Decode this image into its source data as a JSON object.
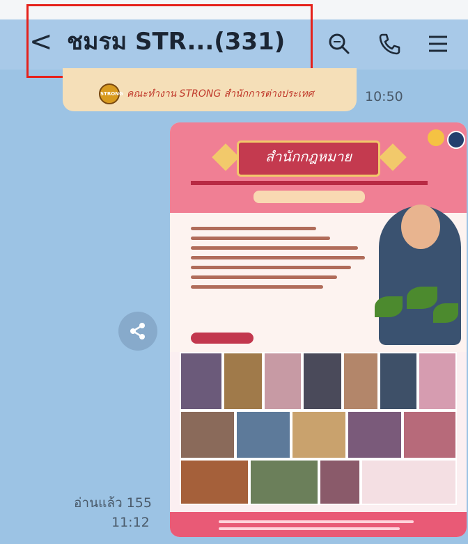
{
  "header": {
    "back_glyph": "<",
    "chat_title": "ชมรม STR...(331)",
    "icons": [
      "search-icon",
      "phone-icon",
      "menu-icon"
    ]
  },
  "messages": {
    "top_bubble": {
      "sender_caption": "คณะทำงาน STRONG สำนักการต่างประเทศ",
      "logo_text": "STRONG",
      "time": "10:50"
    },
    "image_message": {
      "read_status": "อ่านแล้ว 155",
      "time": "11:12",
      "poster_heading": "สำนักกฎหมาย",
      "share_icon": "share-icon"
    }
  },
  "colors": {
    "chat_bg": "#9cc3e4",
    "header_bg": "#a8c9e8",
    "highlight": "#e5211b",
    "bubble_bg": "#f5dfb8"
  }
}
